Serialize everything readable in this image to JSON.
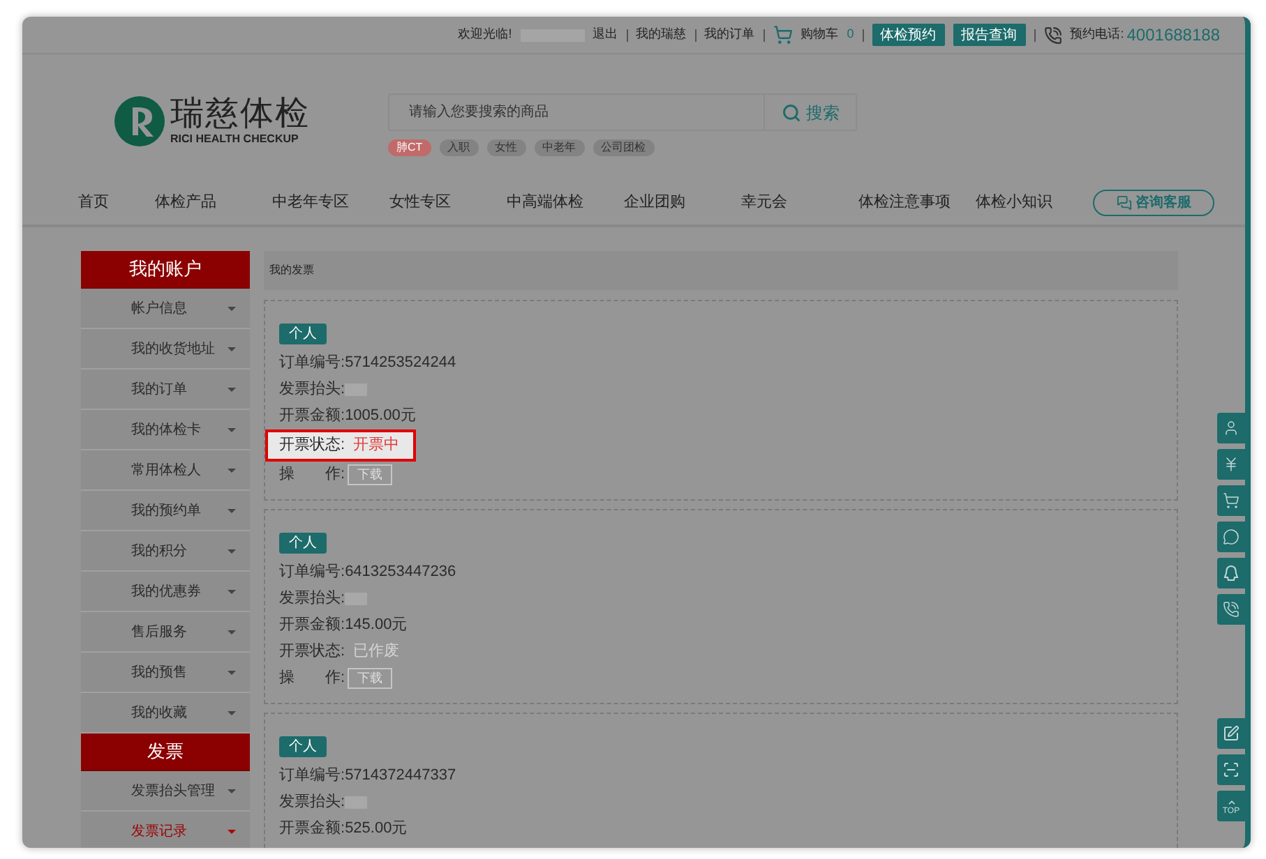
{
  "top_bar": {
    "greeting": "欢迎光临!",
    "logout": "退出",
    "links": [
      "我的瑞慈",
      "我的订单"
    ],
    "cart": {
      "label": "购物车",
      "count": "0"
    },
    "buttons": [
      "体检预约",
      "报告查询"
    ],
    "phone": {
      "label": "预约电话:",
      "number": "4001688188"
    }
  },
  "header": {
    "logo": {
      "name": "瑞慈体检",
      "subtitle": "RICI HEALTH CHECKUP"
    },
    "search": {
      "placeholder": "请输入您要搜索的商品",
      "button": "搜索"
    },
    "hot_tags": [
      {
        "label": "肺CT",
        "color": "#c26a6a"
      },
      {
        "label": "入职",
        "color": "#838383"
      },
      {
        "label": "女性",
        "color": "#838383"
      },
      {
        "label": "中老年",
        "color": "#838383"
      },
      {
        "label": "公司团检",
        "color": "#838383"
      }
    ]
  },
  "nav": {
    "items": [
      "首页",
      "体检产品",
      "中老年专区",
      "女性专区",
      "中高端体检",
      "企业团购",
      "幸元会",
      "体检注意事项",
      "体检小知识"
    ],
    "service_button": "咨询客服"
  },
  "sidebar": {
    "sections": [
      {
        "title": "我的账户",
        "items": [
          {
            "label": "帐户信息",
            "selected": false
          },
          {
            "label": "我的收货地址",
            "selected": false
          },
          {
            "label": "我的订单",
            "selected": false
          },
          {
            "label": "我的体检卡",
            "selected": false
          },
          {
            "label": "常用体检人",
            "selected": false
          },
          {
            "label": "我的预约单",
            "selected": false
          },
          {
            "label": "我的积分",
            "selected": false
          },
          {
            "label": "我的优惠券",
            "selected": false
          },
          {
            "label": "售后服务",
            "selected": false
          },
          {
            "label": "我的预售",
            "selected": false
          },
          {
            "label": "我的收藏",
            "selected": false
          }
        ]
      },
      {
        "title": "发票",
        "items": [
          {
            "label": "发票抬头管理",
            "selected": false
          },
          {
            "label": "发票记录",
            "selected": true
          }
        ]
      }
    ]
  },
  "content": {
    "title": "我的发票",
    "invoices": [
      {
        "type": "个人",
        "order_label": "订单编号:",
        "order_no": "5714253524244",
        "title_label": "发票抬头:",
        "amount_label": "开票金额:",
        "amount": "1005.00元",
        "status_label": "开票状态:",
        "status": {
          "text": "开票中",
          "color": "#e03a3a"
        },
        "highlighted": true,
        "action_label": "操　　作:",
        "action_button": "下载"
      },
      {
        "type": "个人",
        "order_label": "订单编号:",
        "order_no": "6413253447236",
        "title_label": "发票抬头:",
        "amount_label": "开票金额:",
        "amount": "145.00元",
        "status_label": "开票状态:",
        "status": {
          "text": "已作废",
          "color": "#d4d4d4"
        },
        "highlighted": false,
        "action_label": "操　　作:",
        "action_button": "下载"
      },
      {
        "type": "个人",
        "order_label": "订单编号:",
        "order_no": "5714372447337",
        "title_label": "发票抬头:",
        "amount_label": "开票金额:",
        "amount": "525.00元"
      }
    ]
  },
  "side_rail": {
    "top_label": "TOP"
  }
}
